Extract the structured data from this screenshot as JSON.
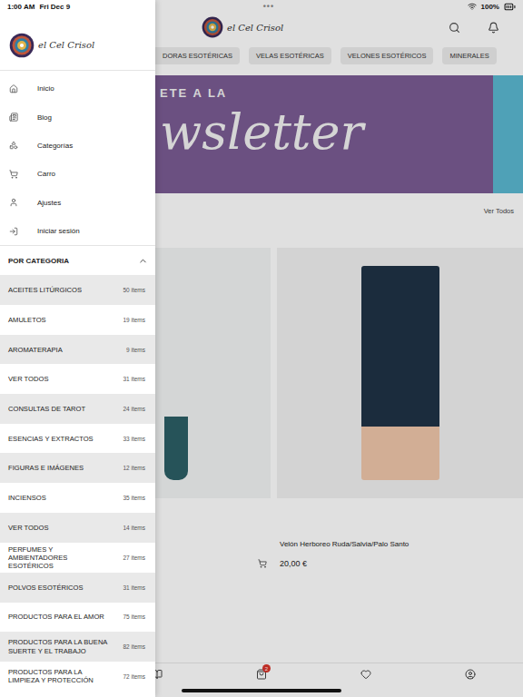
{
  "status_bar": {
    "time": "1:00 AM",
    "date": "Fri Dec 9",
    "dots": "•••",
    "battery": "100%"
  },
  "app": {
    "brand": "el Cel Crisol",
    "chips": [
      "DORAS ESOTÉRICAS",
      "VELAS ESOTÉRICAS",
      "VELONES ESOTÉRICOS",
      "MINERALES"
    ],
    "banner": {
      "line1": "ETE A LA",
      "line2": "wsletter"
    },
    "section_link": "Ver Todos",
    "product": {
      "name": "Velón Herboreo Ruda/Salvia/Palo Santo",
      "price": "20,00 €"
    },
    "cart_badge": "2"
  },
  "drawer": {
    "brand": "el Cel Crisol",
    "menu": [
      {
        "label": "Inicio"
      },
      {
        "label": "Blog"
      },
      {
        "label": "Categorías"
      },
      {
        "label": "Carro"
      },
      {
        "label": "Ajustes"
      },
      {
        "label": "Iniciar sesión"
      }
    ],
    "section": {
      "title": "POR CATEGORIA",
      "expanded": true
    },
    "categories": [
      {
        "name": "ACEITES LITÚRGICOS",
        "count": "50 items"
      },
      {
        "name": "AMULETOS",
        "count": "19 items"
      },
      {
        "name": "AROMATERAPIA",
        "count": "9 items"
      },
      {
        "name": "VER TODOS",
        "count": "31 items"
      },
      {
        "name": "CONSULTAS DE TAROT",
        "count": "24 items"
      },
      {
        "name": "ESENCIAS Y EXTRACTOS",
        "count": "33 items"
      },
      {
        "name": "FIGURAS E IMÁGENES",
        "count": "12 items"
      },
      {
        "name": "INCIENSOS",
        "count": "35 items"
      },
      {
        "name": "VER TODOS",
        "count": "14 items"
      },
      {
        "name": "PERFUMES Y AMBIENTADORES ESOTÉRICOS",
        "count": "27 items"
      },
      {
        "name": "POLVOS ESOTÉRICOS",
        "count": "31 items"
      },
      {
        "name": "PRODUCTOS PARA EL AMOR",
        "count": "75 items"
      },
      {
        "name": "PRODUCTOS PARA LA BUENA SUERTE Y EL TRABAJO",
        "count": "82 items"
      },
      {
        "name": "PRODUCTOS PARA LA LIMPIEZA Y PROTECCIÓN",
        "count": "72 items"
      }
    ]
  }
}
